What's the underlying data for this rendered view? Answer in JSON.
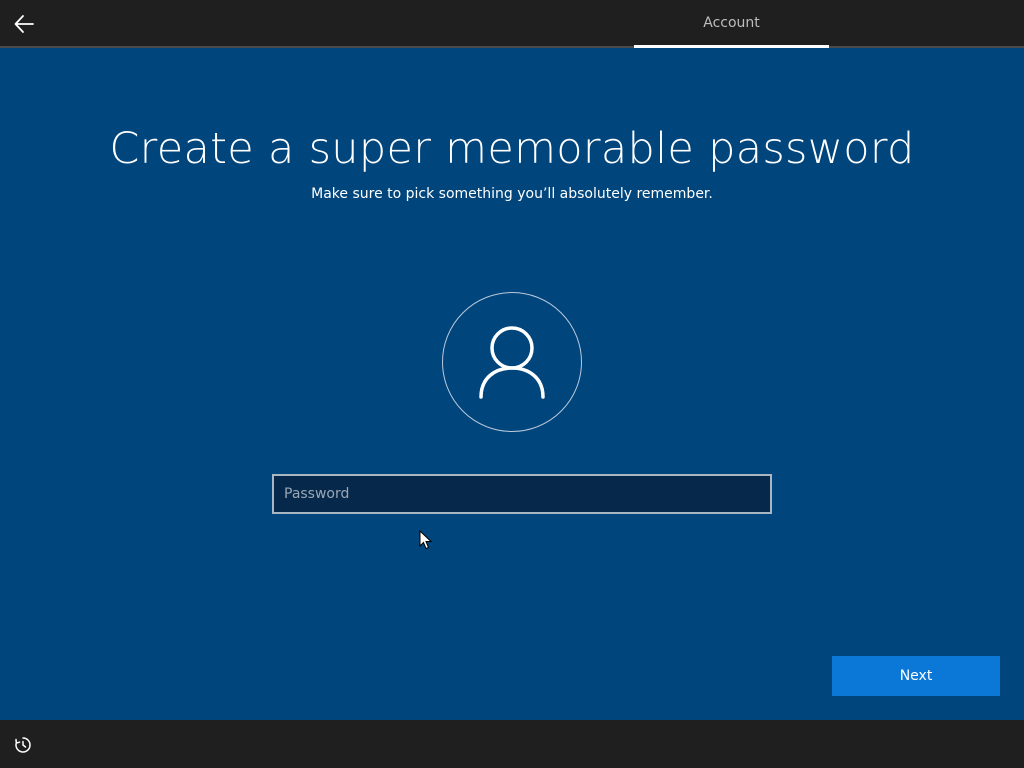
{
  "header": {
    "back_icon": "arrow-left-icon",
    "tab_label": "Account"
  },
  "main": {
    "title": "Create a super memorable password",
    "subtitle": "Make sure to pick something you’ll absolutely remember.",
    "avatar_icon": "user-icon",
    "password_placeholder": "Password",
    "password_value": ""
  },
  "footer": {
    "next_label": "Next",
    "ease_of_access_icon": "ease-of-access-icon"
  },
  "colors": {
    "background": "#00457c",
    "top_bottom_bar": "#1f1f1f",
    "accent_button": "#0b78d7",
    "text": "#ffffff"
  }
}
